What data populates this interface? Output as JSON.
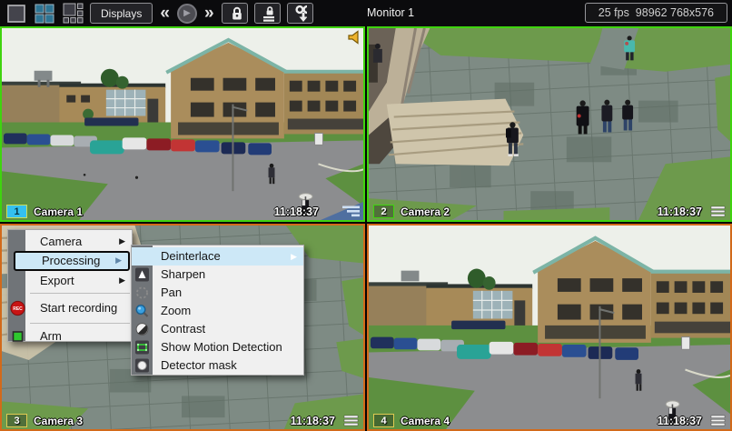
{
  "toolbar": {
    "displays_label": "Displays",
    "monitor_label": "Monitor 1",
    "status": "25 fps  98962 768x576",
    "icons": {
      "rewind": "«",
      "play": "▶",
      "fast_forward": "»"
    }
  },
  "cameras": [
    {
      "number": "1",
      "label": "Camera 1",
      "time": "11:18:37"
    },
    {
      "number": "2",
      "label": "Camera 2",
      "time": "11:18:37"
    },
    {
      "number": "3",
      "label": "Camera 3",
      "time": "11:18:37"
    },
    {
      "number": "4",
      "label": "Camera 4",
      "time": "11:18:37"
    }
  ],
  "context_menu": {
    "items": [
      {
        "label": "Camera",
        "has_submenu": true
      },
      {
        "label": "Processing",
        "has_submenu": true,
        "highlighted": true
      },
      {
        "label": "Export",
        "has_submenu": true
      },
      {
        "label": "Start recording",
        "icon": "rec-icon"
      },
      {
        "label": "Arm",
        "icon": "arm-icon"
      }
    ]
  },
  "processing_submenu": {
    "items": [
      {
        "label": "Deinterlace",
        "has_submenu": true,
        "highlighted": true
      },
      {
        "label": "Sharpen",
        "icon": "sharpen-icon"
      },
      {
        "label": "Pan",
        "icon": "pan-icon"
      },
      {
        "label": "Zoom",
        "icon": "zoom-icon"
      },
      {
        "label": "Contrast",
        "icon": "contrast-icon"
      },
      {
        "label": "Show Motion Detection",
        "icon": "motion-detection-icon"
      },
      {
        "label": "Detector mask",
        "icon": "detector-mask-icon"
      }
    ]
  },
  "colors": {
    "green": "#3fd40e",
    "orange": "#d26a1a",
    "cyan": "#35c0ee",
    "num_yellow": "#dfca52",
    "highlight": "#cde8f7",
    "menu_bg": "#f0f0f0",
    "menu_strip": "#707478"
  }
}
